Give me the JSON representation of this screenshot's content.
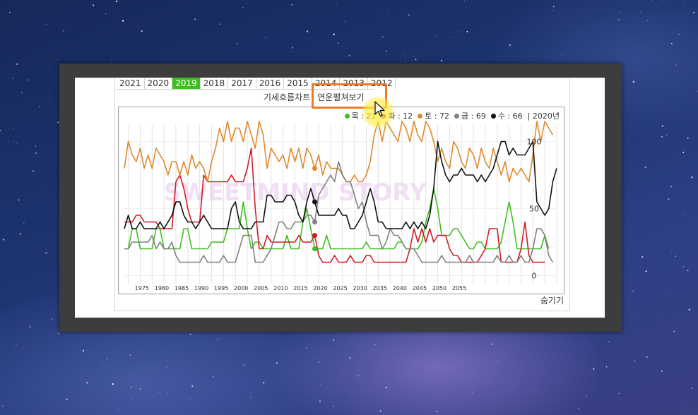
{
  "year_tabs": [
    "2021",
    "2020",
    "2019",
    "2018",
    "2017",
    "2016",
    "2015",
    "2014",
    "2013",
    "2012"
  ],
  "active_year": "2019",
  "view_links": [
    "기세흐름차트",
    "연운펼쳐보기"
  ],
  "hide_label": "숨기기",
  "legend": [
    {
      "label": "목 : 21",
      "color": "#3fbf1e"
    },
    {
      "label": "화 : 12",
      "color": "#d11c25"
    },
    {
      "label": "토 : 72",
      "color": "#dd8a2c"
    },
    {
      "label": "금 : 69",
      "color": "#808080"
    },
    {
      "label": "수 : 66",
      "color": "#111111"
    }
  ],
  "legend_year": "| 2020년",
  "watermark": "SWEETMIND STORY",
  "colors": {
    "accent_tab": "#3fbf1e",
    "highlight": "#ef7b2a",
    "frame": "#3d3d3d"
  },
  "chart_data": {
    "type": "line",
    "x_start": 1972,
    "x_step": 1,
    "x_ticks": [
      1975,
      1980,
      1985,
      1990,
      1995,
      2000,
      2005,
      2010,
      2015,
      2020,
      2025,
      2030,
      2035,
      2040,
      2045,
      2050,
      2055
    ],
    "y_ticks": [
      0,
      50,
      100
    ],
    "ylim": [
      -5,
      115
    ],
    "highlight_x": 2020,
    "series": [
      {
        "name": "목",
        "color": "#3fbf1e",
        "values": [
          20,
          20,
          35,
          35,
          20,
          20,
          20,
          20,
          35,
          35,
          20,
          20,
          20,
          20,
          20,
          35,
          35,
          20,
          20,
          20,
          20,
          20,
          25,
          25,
          25,
          25,
          35,
          35,
          35,
          35,
          55,
          35,
          20,
          25,
          25,
          20,
          20,
          20,
          20,
          20,
          20,
          30,
          20,
          20,
          20,
          40,
          50,
          35,
          20,
          20,
          20,
          30,
          20,
          20,
          20,
          20,
          20,
          20,
          20,
          20,
          20,
          25,
          20,
          20,
          20,
          20,
          20,
          20,
          20,
          25,
          25,
          20,
          20,
          20,
          20,
          25,
          40,
          50,
          65,
          50,
          30,
          30,
          30,
          35,
          35,
          30,
          25,
          20,
          20,
          25,
          25,
          20,
          20,
          20,
          20,
          25,
          40,
          55,
          40,
          20,
          20,
          20,
          20,
          20,
          20,
          20,
          30,
          20
        ]
      },
      {
        "name": "화",
        "color": "#d11c25",
        "values": [
          40,
          40,
          40,
          45,
          45,
          40,
          40,
          40,
          40,
          35,
          35,
          35,
          35,
          70,
          75,
          65,
          50,
          40,
          40,
          40,
          75,
          70,
          70,
          70,
          70,
          70,
          70,
          75,
          70,
          70,
          70,
          80,
          95,
          50,
          20,
          20,
          30,
          25,
          25,
          25,
          25,
          25,
          25,
          25,
          30,
          25,
          25,
          25,
          30,
          15,
          10,
          10,
          10,
          15,
          10,
          10,
          10,
          15,
          10,
          10,
          10,
          15,
          15,
          10,
          10,
          10,
          10,
          10,
          10,
          10,
          10,
          10,
          20,
          35,
          25,
          35,
          25,
          35,
          25,
          30,
          30,
          30,
          20,
          15,
          15,
          10,
          10,
          10,
          10,
          10,
          15,
          20,
          35,
          35,
          35,
          10,
          10,
          10,
          10,
          10,
          20,
          40,
          15,
          10,
          10,
          10,
          10
        ]
      },
      {
        "name": "토",
        "color": "#dd8a2c",
        "values": [
          80,
          100,
          90,
          85,
          95,
          80,
          90,
          80,
          95,
          90,
          85,
          75,
          85,
          85,
          75,
          85,
          75,
          90,
          80,
          85,
          80,
          70,
          85,
          95,
          110,
          100,
          115,
          100,
          110,
          110,
          100,
          115,
          105,
          95,
          115,
          105,
          80,
          95,
          90,
          85,
          90,
          80,
          95,
          85,
          95,
          80,
          95,
          90,
          80,
          90,
          75,
          85,
          80,
          80,
          80,
          75,
          70,
          70,
          75,
          70,
          70,
          75,
          85,
          105,
          115,
          100,
          115,
          110,
          105,
          100,
          115,
          110,
          100,
          115,
          105,
          100,
          115,
          110,
          100,
          85,
          95,
          85,
          80,
          100,
          95,
          85,
          80,
          95,
          90,
          80,
          95,
          85,
          80,
          95,
          85,
          75,
          85,
          70,
          80,
          75,
          80,
          75,
          70,
          90,
          115,
          100,
          115,
          110,
          105
        ]
      },
      {
        "name": "금",
        "color": "#808080",
        "values": [
          20,
          20,
          25,
          25,
          25,
          25,
          25,
          30,
          20,
          25,
          20,
          20,
          25,
          15,
          10,
          10,
          10,
          10,
          10,
          10,
          15,
          10,
          10,
          10,
          10,
          15,
          10,
          10,
          10,
          20,
          30,
          30,
          30,
          10,
          10,
          10,
          15,
          20,
          30,
          40,
          40,
          35,
          35,
          40,
          40,
          40,
          45,
          45,
          40,
          60,
          65,
          70,
          75,
          70,
          85,
          75,
          70,
          70,
          60,
          50,
          55,
          40,
          30,
          30,
          30,
          20,
          25,
          35,
          30,
          30,
          25,
          20,
          20,
          20,
          15,
          10,
          10,
          10,
          10,
          10,
          15,
          10,
          10,
          10,
          10,
          10,
          10,
          15,
          10,
          10,
          10,
          10,
          10,
          10,
          15,
          10,
          10,
          15,
          10,
          10,
          15,
          10,
          10,
          20,
          35,
          35,
          30,
          15,
          10
        ]
      },
      {
        "name": "수",
        "color": "#111111",
        "values": [
          35,
          45,
          35,
          35,
          40,
          35,
          35,
          35,
          35,
          40,
          35,
          40,
          45,
          55,
          55,
          45,
          40,
          40,
          35,
          40,
          45,
          40,
          35,
          35,
          35,
          35,
          35,
          50,
          55,
          40,
          35,
          35,
          35,
          40,
          40,
          40,
          60,
          60,
          55,
          55,
          55,
          60,
          60,
          55,
          45,
          40,
          55,
          65,
          55,
          45,
          45,
          45,
          45,
          45,
          50,
          45,
          45,
          35,
          35,
          40,
          45,
          55,
          65,
          55,
          40,
          40,
          35,
          35,
          35,
          35,
          35,
          40,
          35,
          40,
          35,
          40,
          35,
          45,
          65,
          100,
          85,
          75,
          70,
          75,
          75,
          80,
          75,
          75,
          75,
          70,
          75,
          70,
          75,
          80,
          90,
          100,
          100,
          90,
          95,
          90,
          90,
          90,
          95,
          100,
          55,
          50,
          45,
          50,
          70,
          80
        ]
      }
    ]
  }
}
